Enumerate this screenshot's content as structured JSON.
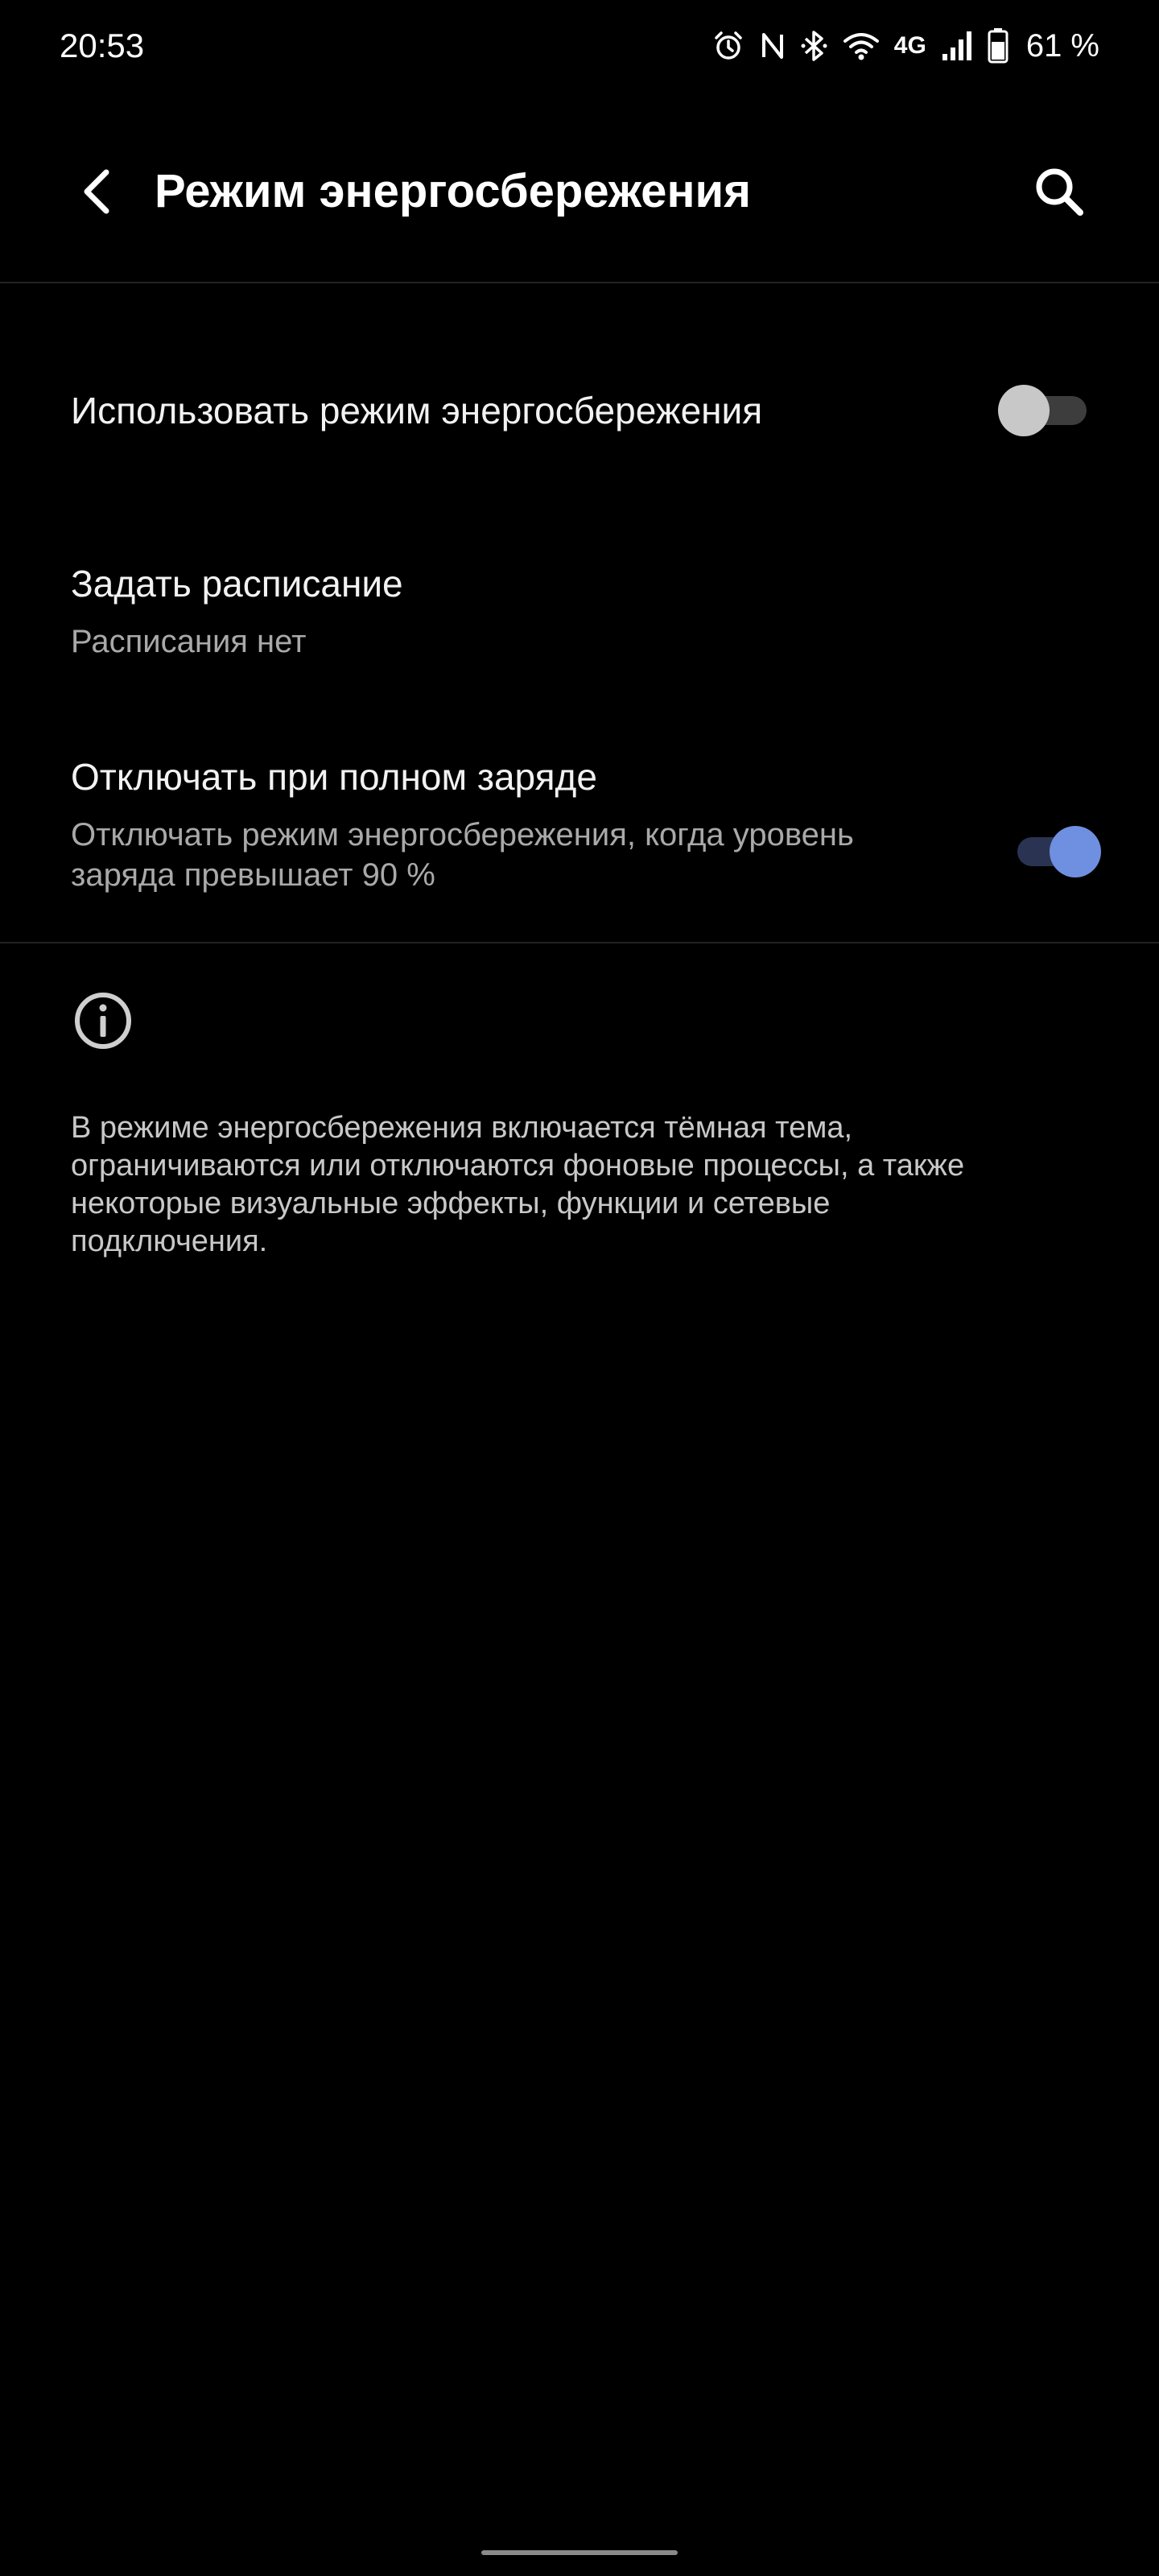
{
  "status_bar": {
    "time": "20:53",
    "network": "4G",
    "battery": "61 %",
    "icons": [
      "alarm-icon",
      "nfc-icon",
      "bluetooth-icon",
      "wifi-icon",
      "signal-icon",
      "battery-icon"
    ]
  },
  "app_bar": {
    "title": "Режим энергосбережения",
    "back_icon": "back-arrow-icon",
    "search_icon": "search-icon"
  },
  "settings": {
    "use_saver": {
      "title": "Использовать режим энергосбережения",
      "enabled": false
    },
    "schedule": {
      "title": "Задать расписание",
      "summary": "Расписания нет"
    },
    "turn_off_full": {
      "title": "Отключать при полном заряде",
      "summary": "Отключать режим энергосбережения, когда уровень заряда превышает 90 %",
      "enabled": true
    }
  },
  "footer": {
    "icon": "info-icon",
    "text": "В режиме энергосбережения включается тёмная тема, ограничиваются или отключаются фоновые процессы, а также некоторые визуальные эффекты, функции и сетевые подключения."
  },
  "colors": {
    "background": "#000000",
    "accent": "#6f8fe0",
    "text_primary": "#f2f2f2",
    "text_secondary": "#a9a9a9"
  }
}
